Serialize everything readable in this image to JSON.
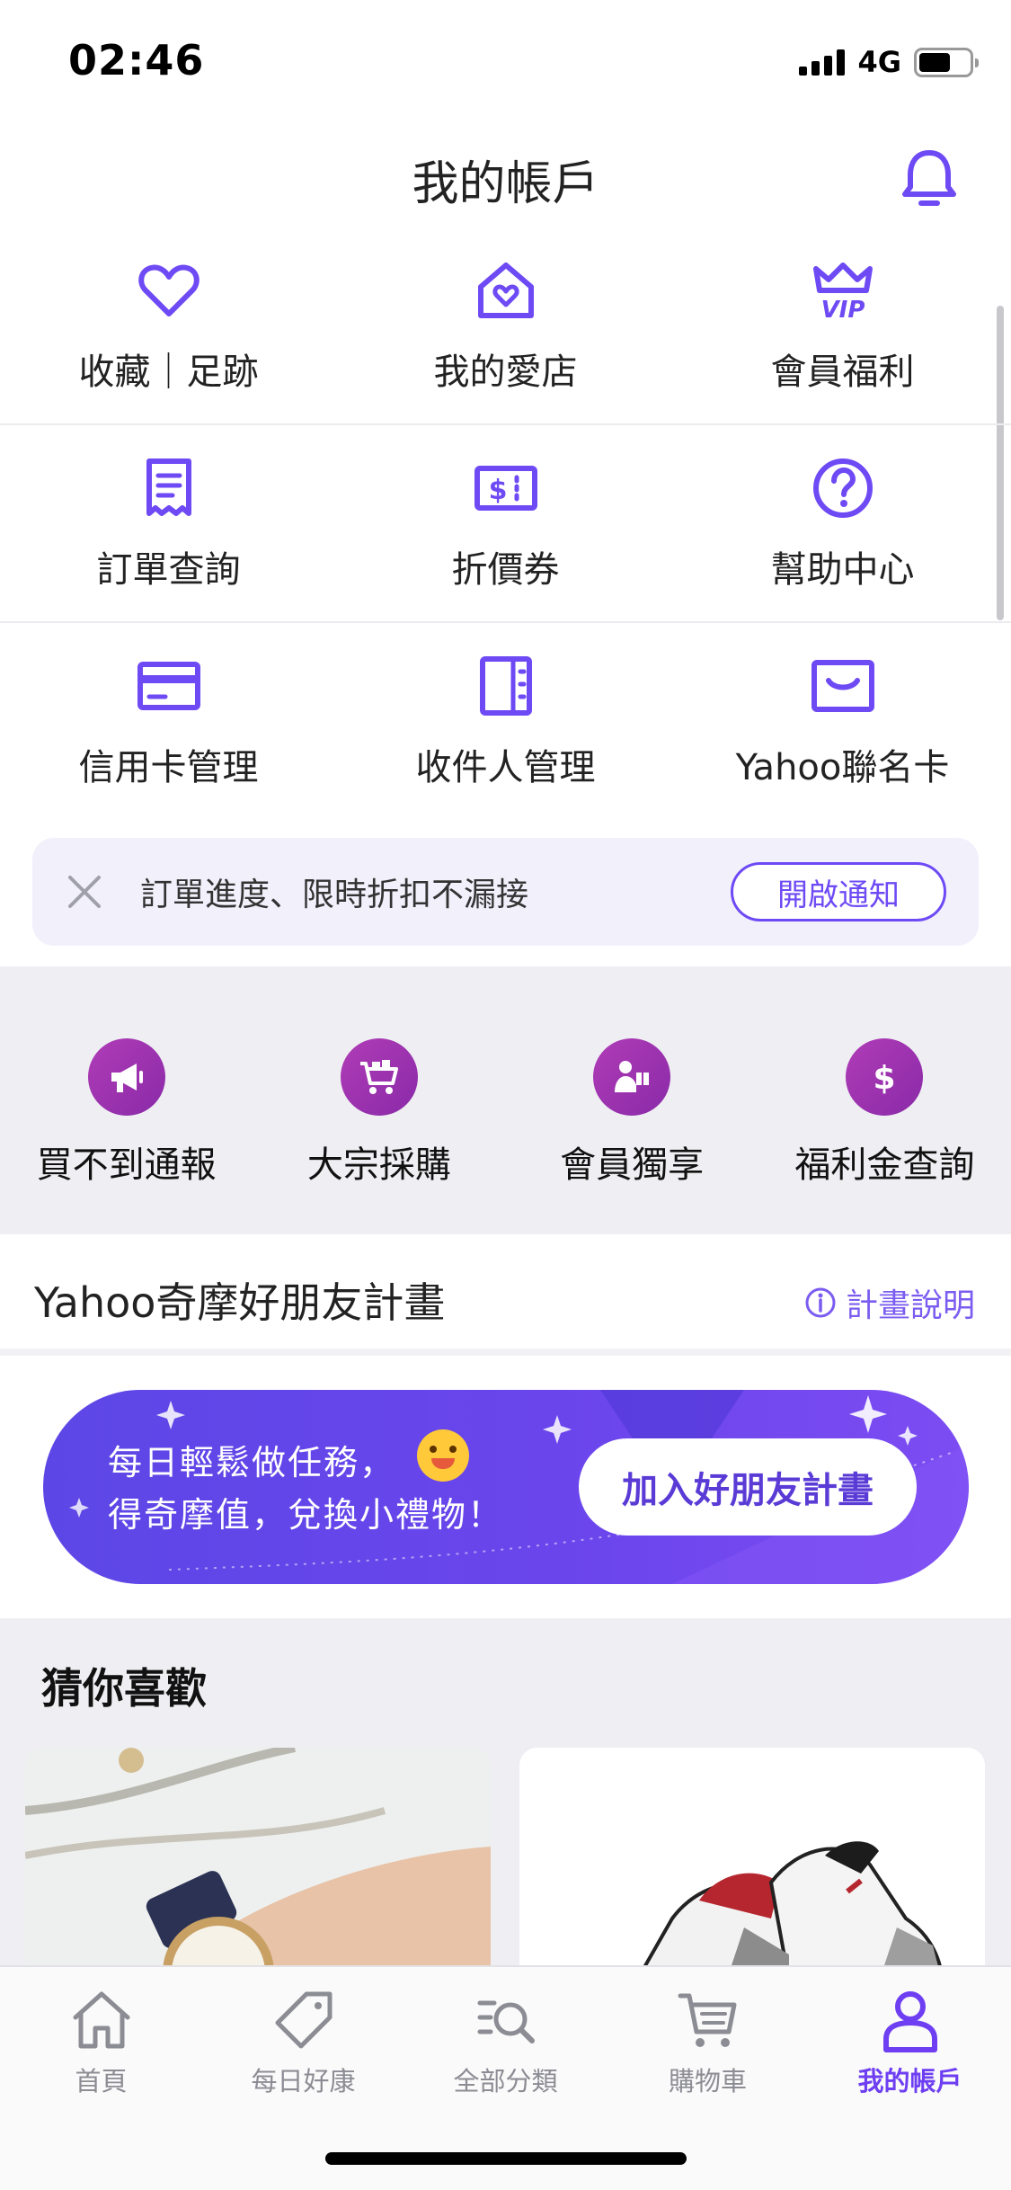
{
  "status_bar": {
    "time": "02:46",
    "network": "4G"
  },
  "header": {
    "title": "我的帳戶"
  },
  "account_menu": [
    {
      "label": "收藏｜足跡",
      "icon": "heart-icon"
    },
    {
      "label": "我的愛店",
      "icon": "store-heart-icon"
    },
    {
      "label": "會員福利",
      "icon": "vip-crown-icon"
    },
    {
      "label": "訂單查詢",
      "icon": "receipt-icon"
    },
    {
      "label": "折價券",
      "icon": "coupon-icon"
    },
    {
      "label": "幫助中心",
      "icon": "help-icon"
    },
    {
      "label": "信用卡管理",
      "icon": "credit-card-icon"
    },
    {
      "label": "收件人管理",
      "icon": "address-book-icon"
    },
    {
      "label": "Yahoo聯名卡",
      "icon": "cobrand-card-icon"
    }
  ],
  "notification_banner": {
    "text": "訂單進度、限時折扣不漏接",
    "button": "開啟通知"
  },
  "quick_links": [
    {
      "label": "買不到通報",
      "icon": "megaphone-icon"
    },
    {
      "label": "大宗採購",
      "icon": "bulk-cart-icon"
    },
    {
      "label": "會員獨享",
      "icon": "member-gift-icon"
    },
    {
      "label": "福利金查詢",
      "icon": "dollar-icon"
    }
  ],
  "friends_program": {
    "title": "Yahoo奇摩好朋友計畫",
    "help": "計畫說明",
    "banner_line1": "每日輕鬆做任務，",
    "banner_line2": "得奇摩值，兌換小禮物！",
    "banner_button": "加入好朋友計畫"
  },
  "recommendations": {
    "title": "猜你喜歡"
  },
  "tab_bar": [
    {
      "label": "首頁",
      "icon": "home-icon",
      "active": false
    },
    {
      "label": "每日好康",
      "icon": "tag-icon",
      "active": false
    },
    {
      "label": "全部分類",
      "icon": "category-search-icon",
      "active": false
    },
    {
      "label": "購物車",
      "icon": "cart-icon",
      "active": false
    },
    {
      "label": "我的帳戶",
      "icon": "account-icon",
      "active": true
    }
  ],
  "colors": {
    "accent": "#6e4af5",
    "quick_icon_bg": "#a232b0",
    "gray_bg": "#efeff3"
  }
}
